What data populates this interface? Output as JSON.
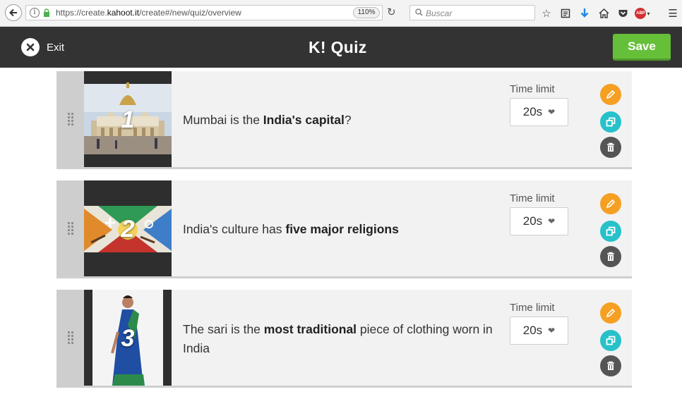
{
  "browser": {
    "url_prefix": "https://create.",
    "url_domain": "kahoot.it",
    "url_suffix": "/create#/new/quiz/overview",
    "zoom": "110%",
    "search_placeholder": "Buscar",
    "adblock_label": "ABP"
  },
  "header": {
    "exit_label": "Exit",
    "logo": "K!",
    "title": "Quiz",
    "save_label": "Save"
  },
  "questions": [
    {
      "number": "1",
      "text_before": "Mumbai is the ",
      "text_bold": "India's capital",
      "text_after": "?",
      "time_label": "Time limit",
      "time_value": "20s"
    },
    {
      "number": "2",
      "text_before": "India's culture has ",
      "text_bold": "five major religions",
      "text_after": "",
      "time_label": "Time limit",
      "time_value": "20s"
    },
    {
      "number": "3",
      "text_before": "The sari is the ",
      "text_bold": "most traditional",
      "text_after": " piece of clothing worn in India",
      "time_label": "Time limit",
      "time_value": "20s"
    }
  ],
  "icons": {
    "edit": "pencil-icon",
    "duplicate": "duplicate-icon",
    "delete": "trash-icon",
    "drag": "drag-handle-icon"
  },
  "colors": {
    "header_bg": "#333333",
    "save_green": "#66bf39",
    "edit_orange": "#f5a023",
    "duplicate_teal": "#26c1c9",
    "delete_gray": "#555555"
  }
}
